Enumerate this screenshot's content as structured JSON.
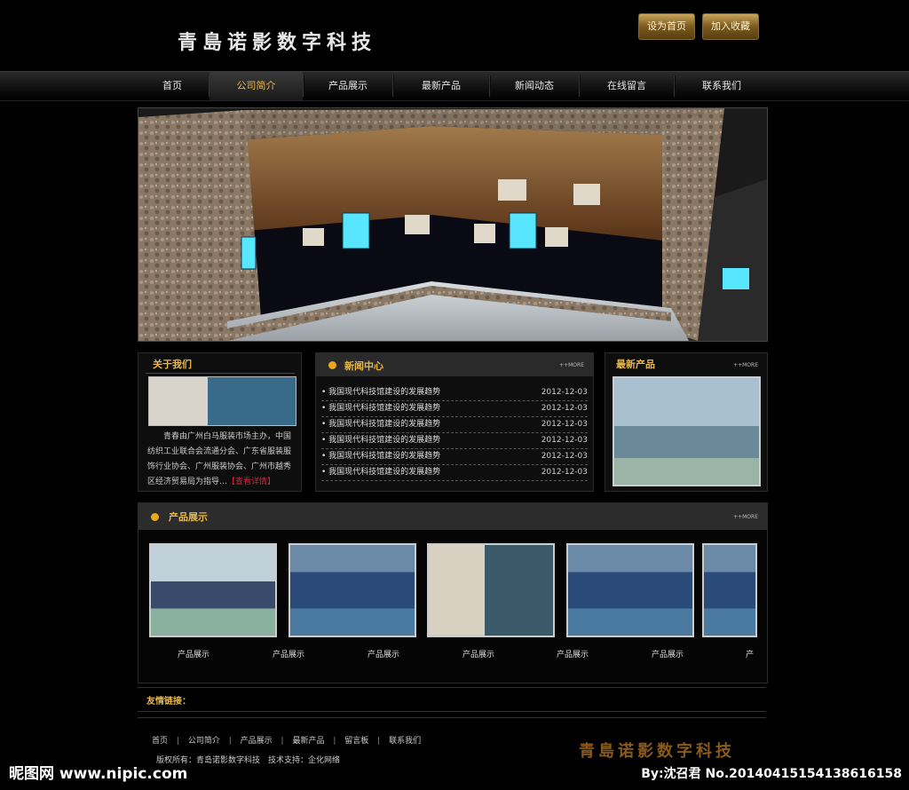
{
  "header": {
    "logo_text": "青島诺影数字科技",
    "btn_home": "设为首页",
    "btn_fav": "加入收藏"
  },
  "nav": {
    "items": [
      "首页",
      "公司简介",
      "产品展示",
      "最新产品",
      "新闻动态",
      "在线留言",
      "联系我们"
    ],
    "active_index": 1
  },
  "about": {
    "title": "关于我们",
    "text": "青春由广州白马服装市场主办，中国纺织工业联合会流通分会、广东省服装服饰行业协会、广州服装协会、广州市越秀区经济贸易局为指导…",
    "more": "【查看详情】"
  },
  "news": {
    "title": "新闻中心",
    "more": "++MORE",
    "rows": [
      {
        "text": "我国现代科技馆建设的发展趋势",
        "date": "2012-12-03"
      },
      {
        "text": "我国现代科技馆建设的发展趋势",
        "date": "2012-12-03"
      },
      {
        "text": "我国现代科技馆建设的发展趋势",
        "date": "2012-12-03"
      },
      {
        "text": "我国现代科技馆建设的发展趋势",
        "date": "2012-12-03"
      },
      {
        "text": "我国现代科技馆建设的发展趋势",
        "date": "2012-12-03"
      },
      {
        "text": "我国现代科技馆建设的发展趋势",
        "date": "2012-12-03"
      }
    ]
  },
  "latest": {
    "title": "最新产品",
    "more": "++MORE"
  },
  "products": {
    "title": "产品展示",
    "more": "++MORE",
    "captions": [
      "产品展示",
      "产品展示",
      "产品展示",
      "产品展示",
      "产品展示",
      "产品展示",
      "产"
    ]
  },
  "links": {
    "title": "友情链接："
  },
  "footer": {
    "links": [
      "首页",
      "公司简介",
      "产品展示",
      "最新产品",
      "留言板",
      "联系我们"
    ],
    "separator": "|",
    "copyright": "版权所有：青岛诺影数字科技　技术支持：企化网络",
    "logo_text": "青島诺影数字科技"
  },
  "watermark": {
    "left": "昵图网 www.nipic.com",
    "right": "By:沈召君 No.20140415154138616158"
  }
}
